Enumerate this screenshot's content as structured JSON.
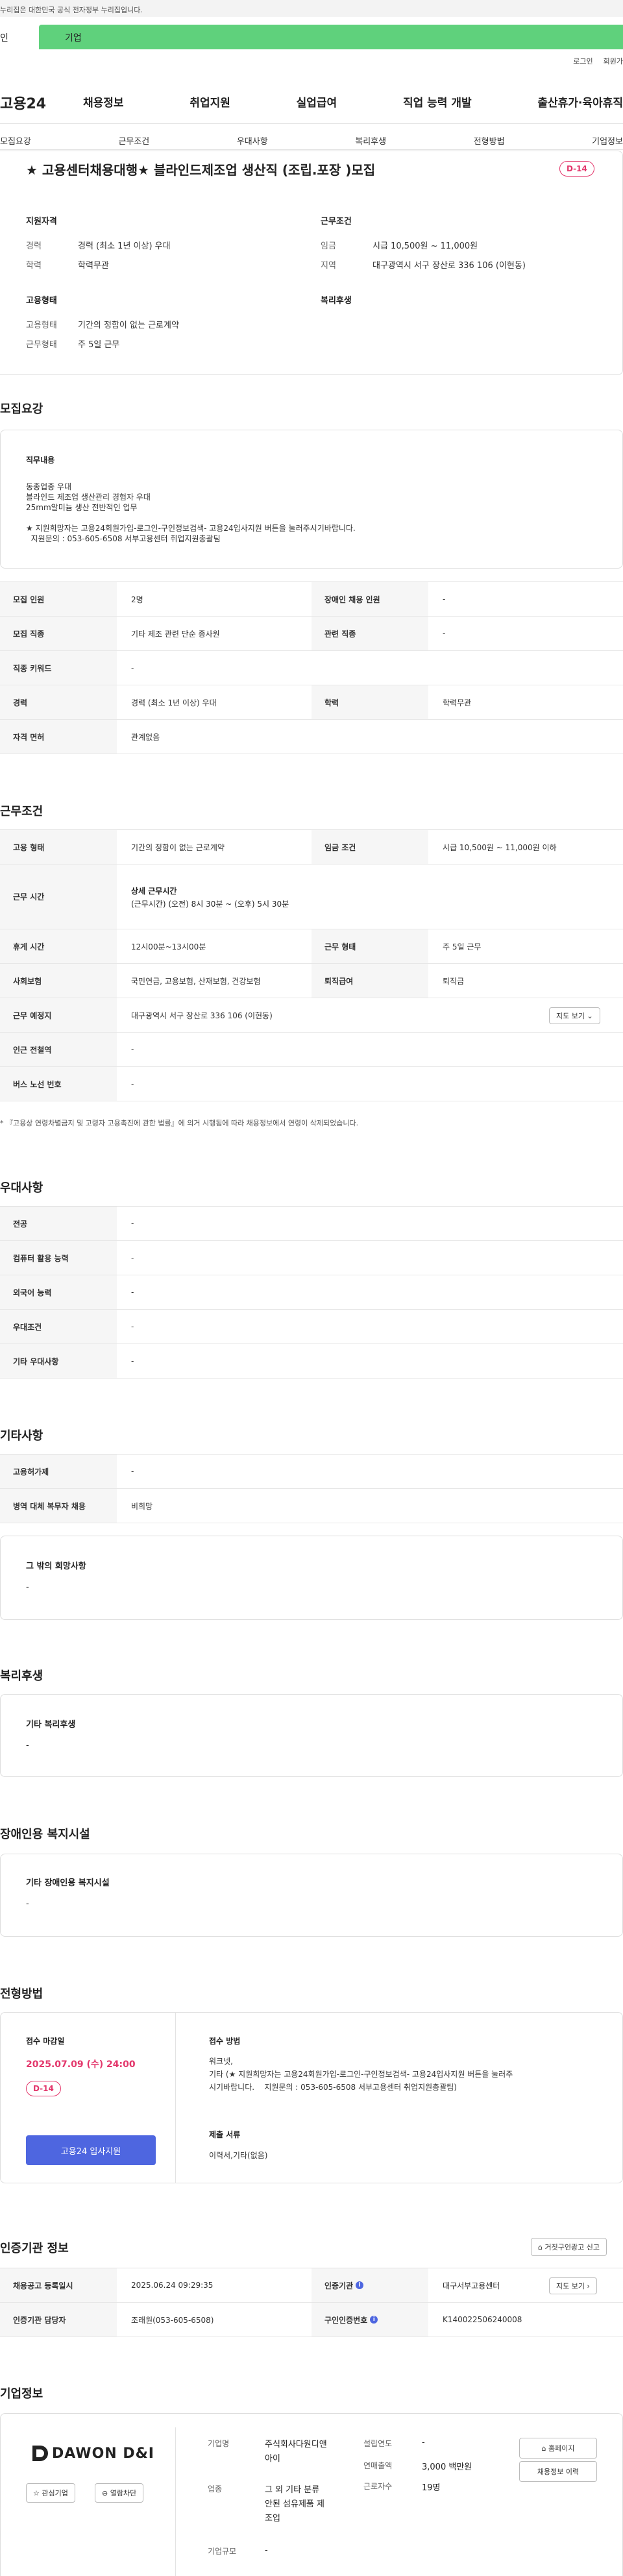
{
  "gov_banner": "누리집은 대한민국 공식 전자정부 누리집입니다.",
  "tabs": [
    "인",
    "기업"
  ],
  "util": [
    "로그인",
    "회원가"
  ],
  "brand": "고용24",
  "gnb": [
    "채용정보",
    "취업지원",
    "실업급여",
    "직업 능력 개발",
    "출산휴가·육아휴직"
  ],
  "snb": [
    "모집요강",
    "근무조건",
    "우대사항",
    "복리후생",
    "전형방법",
    "기업정보"
  ],
  "job": {
    "title": "★ 고용센터채용대행★ 블라인드제조업 생산직 (조립.포장 )모집",
    "dday": "D-14",
    "qual_h": "지원자격",
    "career_k": "경력",
    "career_v": "경력 (최소 1년 이상) 우대",
    "edu_k": "학력",
    "edu_v": "학력무관",
    "cond_h": "근무조건",
    "wage_k": "임금",
    "wage_v": "시급 10,500원 ~ 11,000원",
    "area_k": "지역",
    "area_v": "대구광역시 서구 장산로 336 106 (이현동)",
    "emp_h": "고용형태",
    "emptype_k": "고용형태",
    "emptype_v": "기간의 정함이 없는 근로계약",
    "worktype_k": "근무형태",
    "worktype_v": "주 5일 근무",
    "welfare_h": "복리후생"
  },
  "recruit": {
    "h": "모집요강",
    "duty_h": "직무내용",
    "duty_lines": [
      "동종업종 우대",
      "블라인드 제조업 생산관리 경험자 우대",
      "25mm알미늄 생산 전반적인 업무",
      "",
      "★ 지원희망자는 고용24회원가입-로그인-구인정보검색- 고용24입사지원 버튼을 눌러주시기바랍니다.",
      "  지원문의 : 053-605-6508 서부고용센터 취업지원총괄팀"
    ],
    "rows": [
      [
        "모집 인원",
        "2명",
        "장애인 채용 인원",
        "-"
      ],
      [
        "모집 직종",
        "기타 제조 관련 단순 종사원",
        "관련 직종",
        "-"
      ],
      [
        "직종 키워드",
        "-"
      ],
      [
        "경력",
        "경력 (최소 1년 이상) 우대",
        "학력",
        "학력무관"
      ],
      [
        "자격 면허",
        "관계없음"
      ]
    ]
  },
  "work": {
    "h": "근무조건",
    "r1": [
      "고용 형태",
      "기간의 정함이 없는 근로계약",
      "임금 조건",
      "시급 10,500원 ~ 11,000원 이하"
    ],
    "r2k": "근무 시간",
    "r2t": "상세 근무시간",
    "r2v": "(근무시간) (오전) 8시 30분 ~ (오후) 5시 30분",
    "r3": [
      "휴게 시간",
      "12시00분~13시00분",
      "근무 형태",
      "주 5일 근무"
    ],
    "r4": [
      "사회보험",
      "국민연금, 고용보험, 산재보험, 건강보험",
      "퇴직급여",
      "퇴직금"
    ],
    "r5": [
      "근무 예정지",
      "대구광역시 서구 장산로 336 106 (이현동)"
    ],
    "map_btn": "지도 보기 ⌄",
    "r6": [
      "인근 전철역",
      "-"
    ],
    "r7": [
      "버스 노선 번호",
      "-"
    ],
    "note": "* 『고용상 연령차별금지 및 고령자 고용촉진에 관한 법률』에 의거 시행됨에 따라 채용정보에서 연령이 삭제되었습니다."
  },
  "pref": {
    "h": "우대사항",
    "rows": [
      [
        "전공",
        "-"
      ],
      [
        "컴퓨터 활용 능력",
        "-"
      ],
      [
        "외국어 능력",
        "-"
      ],
      [
        "우대조건",
        "-"
      ],
      [
        "기타 우대사항",
        "-"
      ]
    ]
  },
  "etc": {
    "h": "기타사항",
    "rows": [
      [
        "고용허가제",
        "-"
      ],
      [
        "병역 대체 복무자 채용",
        "비희망"
      ]
    ],
    "box_h": "그 밖의 희망사항",
    "box_v": "-"
  },
  "welfare": {
    "h": "복리후생",
    "box_h": "기타 복리후생",
    "box_v": "-"
  },
  "disab": {
    "h": "장애인용 복지시설",
    "box_h": "기타 장애인용 복지시설",
    "box_v": "-"
  },
  "select": {
    "h": "전형방법",
    "deadline_h": "접수 마감일",
    "deadline": "2025.07.09 (수) 24:00",
    "dday": "D-14",
    "apply": "고용24 입사지원",
    "method_h": "접수 방법",
    "method_lines": [
      "워크넷,",
      "기타 (★ 지원희망자는 고용24회원가입-로그인-구인정보검색- 고용24입사지원 버튼을 눌러주",
      "시기바랍니다.    지원문의 : 053-605-6508 서부고용센터 취업지원총괄팀)"
    ],
    "docs_h": "제출 서류",
    "docs_v": "이력서,기타(없음)"
  },
  "cert": {
    "h": "인증기관 정보",
    "report": "거짓구인광고 신고",
    "r1": [
      "채용공고 등록일시",
      "2025.06.24 09:29:35",
      "인증기관",
      "대구서부고용센터"
    ],
    "map_btn": "지도 보기 ›",
    "r2": [
      "인증기관 담당자",
      "조래원(053-605-6508)",
      "구인인증번호",
      "K140022506240008"
    ]
  },
  "company": {
    "h": "기업정보",
    "logo": "DAWON D&I",
    "fav": "☆ 관심기업",
    "block": "⊖ 열람차단",
    "name_k": "기업명",
    "name_v": [
      "주식회사다원디앤",
      "아이"
    ],
    "biz_k": "업종",
    "biz_v": [
      "그 외 기타 분류",
      "안된 섬유제품 제",
      "조업"
    ],
    "scale_k": "기업규모",
    "scale_v": "-",
    "year_k": "설립연도",
    "year_v": "-",
    "sales_k": "연매출액",
    "sales_v": "3,000 백만원",
    "emp_k": "근로자수",
    "emp_v": "19명",
    "home": "홈페이지",
    "history": "채용정보 이력"
  }
}
